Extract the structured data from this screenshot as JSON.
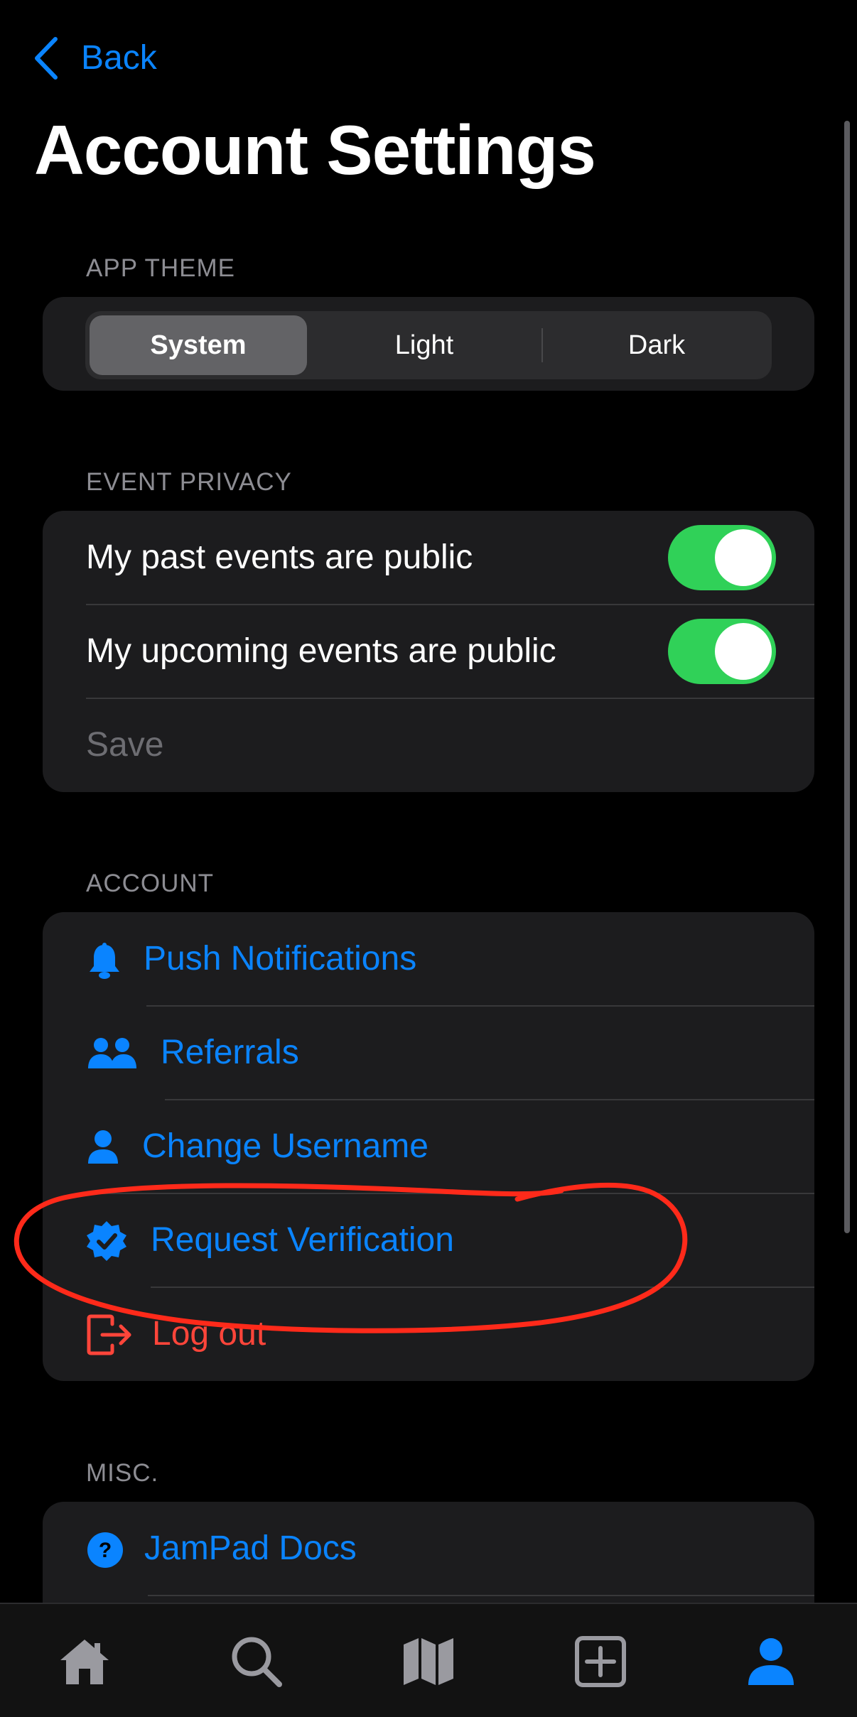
{
  "nav": {
    "back_label": "Back"
  },
  "page_title": "Account Settings",
  "app_theme": {
    "header": "APP THEME",
    "options": [
      "System",
      "Light",
      "Dark"
    ],
    "selected": "System"
  },
  "event_privacy": {
    "header": "EVENT PRIVACY",
    "past_label": "My past events are public",
    "past_on": true,
    "upcoming_label": "My upcoming events are public",
    "upcoming_on": true,
    "save_label": "Save"
  },
  "account": {
    "header": "ACCOUNT",
    "items": [
      {
        "label": "Push Notifications",
        "icon": "bell-icon"
      },
      {
        "label": "Referrals",
        "icon": "people-icon"
      },
      {
        "label": "Change Username",
        "icon": "person-icon"
      },
      {
        "label": "Request Verification",
        "icon": "verified-badge-icon"
      },
      {
        "label": "Log out",
        "icon": "logout-icon"
      }
    ]
  },
  "misc": {
    "header": "MISC.",
    "items": [
      {
        "label": "JamPad Docs",
        "icon": "question-icon"
      }
    ]
  },
  "tabbar": {
    "tabs": [
      "home-icon",
      "search-icon",
      "map-icon",
      "add-icon",
      "profile-icon"
    ],
    "active": "profile-icon"
  },
  "colors": {
    "accent": "#0a84ff",
    "danger": "#ff453a",
    "toggle_on": "#30d158",
    "annotation": "#ff2a1a"
  }
}
